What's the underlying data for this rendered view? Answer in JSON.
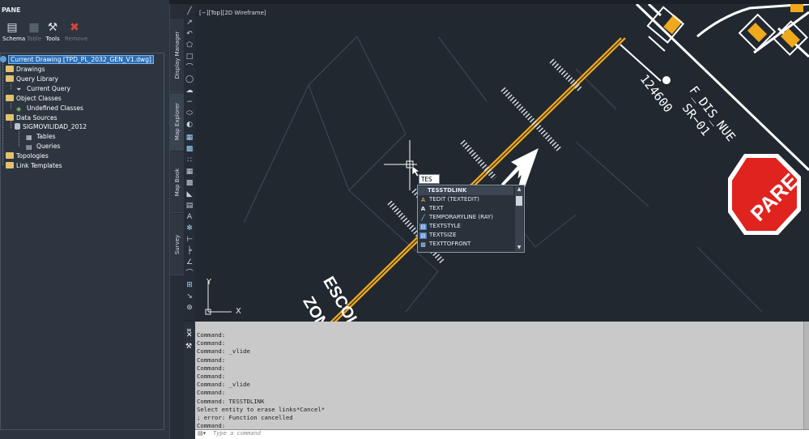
{
  "panel": {
    "title": "PANE",
    "toolbar": [
      {
        "label": "Schema",
        "icon": "schema-icon",
        "enabled": true
      },
      {
        "label": "Table",
        "icon": "table-icon",
        "enabled": false
      },
      {
        "label": "Tools",
        "icon": "tools-icon",
        "enabled": true
      },
      {
        "label": "Remove",
        "icon": "remove-icon",
        "enabled": false
      }
    ],
    "tree": {
      "current_drawing": "Current Drawing [TPD_PL_2032_GEN_V1.dwg]",
      "drawings": "Drawings",
      "query_library": "Query Library",
      "current_query": "Current Query",
      "object_classes": "Object Classes",
      "undefined_classes": "Undefined Classes",
      "data_sources": "Data Sources",
      "sigmovilidad": "SIGMOVILIDAD_2012",
      "tables": "Tables",
      "queries": "Queries",
      "topologies": "Topologies",
      "link_templates": "Link Templates"
    }
  },
  "tabs": [
    "Display Manager",
    "Map Explorer",
    "Map Book",
    "Survey"
  ],
  "viewport": {
    "label": "[−][Top][2D Wireframe]",
    "marking_escolar": "ESCOLAR",
    "marking_zona": "ZONA",
    "text_124600": "124600",
    "text_f_dis": "F_DIS_NUE",
    "text_sr": "SR−01",
    "stop_sign": "PARE",
    "ucs_x": "X",
    "ucs_y": "Y"
  },
  "autocomplete": {
    "typed": "TES",
    "items": [
      {
        "label": "TESSTDLINK",
        "icon": ""
      },
      {
        "label": "TEDIT (TEXTEDIT)",
        "icon": "textedit-icon"
      },
      {
        "label": "TEXT",
        "icon": "text-icon"
      },
      {
        "label": "TEMPORARYLINE (RAY)",
        "icon": "ray-icon"
      },
      {
        "label": "TEXTSTYLE",
        "icon": "textstyle-icon"
      },
      {
        "label": "TEXTSIZE",
        "icon": "textsize-icon"
      },
      {
        "label": "TEXTTOFRONT",
        "icon": "texttofront-icon"
      }
    ]
  },
  "command": {
    "history": [
      "Command:",
      "Command:",
      "Command: _vlide",
      "Command:",
      "Command:",
      "Command:",
      "Command: _vlide",
      "Command:",
      "Command: TESSTDLINK",
      "Select entity to erase links*Cancel*",
      "; error: Function cancelled",
      "Command:"
    ],
    "placeholder": "Type a command"
  },
  "colors": {
    "road_line": "#f0a81c",
    "stop_sign": "#e0231e",
    "marking": "#ffffff",
    "background": "#212830"
  }
}
